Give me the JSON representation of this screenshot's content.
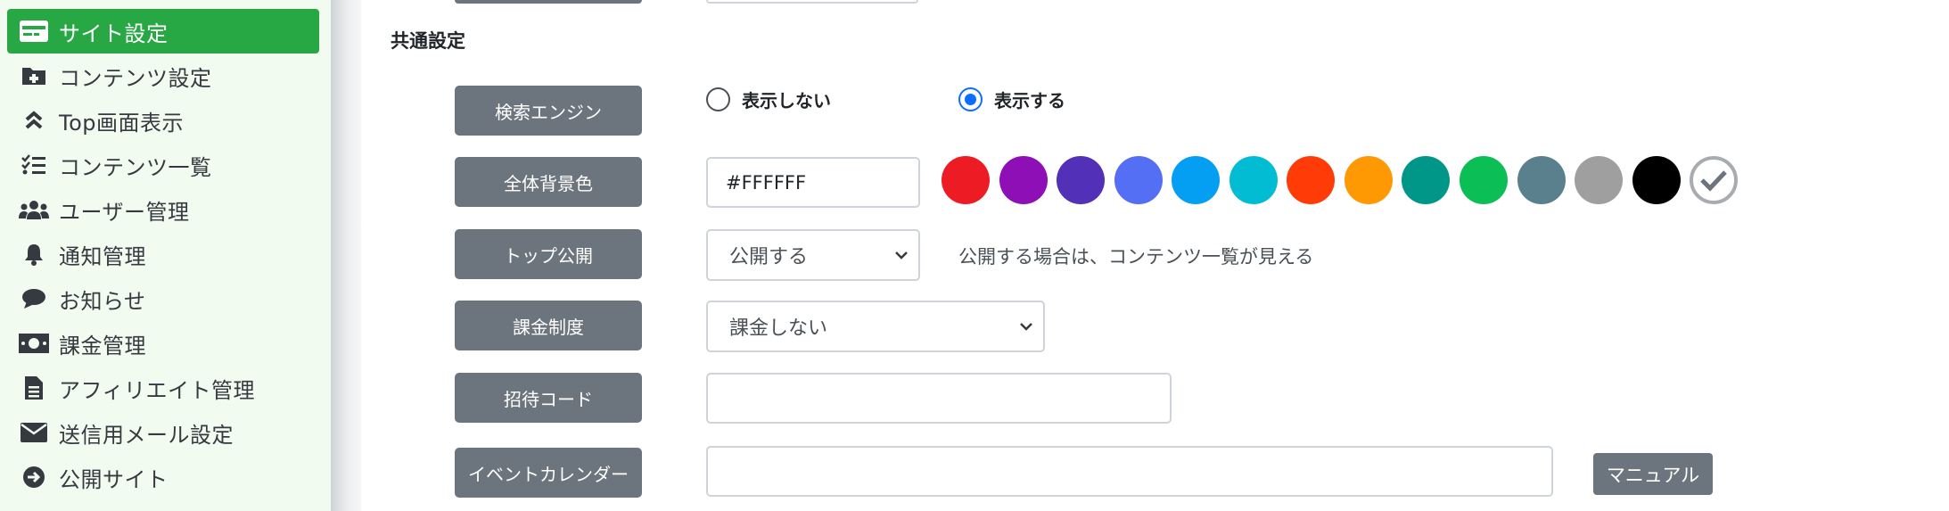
{
  "sidebar": {
    "items": [
      {
        "label": "サイト設定",
        "icon": "card-icon"
      },
      {
        "label": "コンテンツ設定",
        "icon": "folder-plus-icon"
      },
      {
        "label": "Top画面表示",
        "icon": "double-chevron-up-icon"
      },
      {
        "label": "コンテンツ一覧",
        "icon": "checklist-icon"
      },
      {
        "label": "ユーザー管理",
        "icon": "users-icon"
      },
      {
        "label": "通知管理",
        "icon": "bell-icon"
      },
      {
        "label": "お知らせ",
        "icon": "chat-bubble-icon"
      },
      {
        "label": "課金管理",
        "icon": "money-icon"
      },
      {
        "label": "アフィリエイト管理",
        "icon": "document-icon"
      },
      {
        "label": "送信用メール設定",
        "icon": "envelope-icon"
      },
      {
        "label": "公開サイト",
        "icon": "arrow-circle-right-icon"
      }
    ],
    "active_index": 0
  },
  "section": {
    "title": "共通設定"
  },
  "fields": {
    "search_engine": {
      "label": "検索エンジン",
      "options": [
        "表示しない",
        "表示する"
      ],
      "selected": "表示する"
    },
    "background_color": {
      "label": "全体背景色",
      "value": "#FFFFFF",
      "swatches": [
        "#ed1b24",
        "#8e0fb5",
        "#5230b8",
        "#546ef4",
        "#049ff2",
        "#02bcd4",
        "#ff3c08",
        "#ff9903",
        "#019788",
        "#0bbf56",
        "#5a7f8d",
        "#9f9f9f",
        "#000000"
      ],
      "selected_swatch": "#ffffff"
    },
    "top_publish": {
      "label": "トップ公開",
      "value": "公開する",
      "help": "公開する場合は、コンテンツ一覧が見える"
    },
    "billing": {
      "label": "課金制度",
      "value": "課金しない"
    },
    "invite_code": {
      "label": "招待コード",
      "value": ""
    },
    "event_calendar": {
      "label": "イベントカレンダー",
      "value": "",
      "manual_button": "マニュアル"
    }
  },
  "colors": {
    "active_green": "#28a745",
    "sidebar_bg": "#f1fbef",
    "label_gray": "#6c757d",
    "radio_blue": "#0d6efd"
  }
}
